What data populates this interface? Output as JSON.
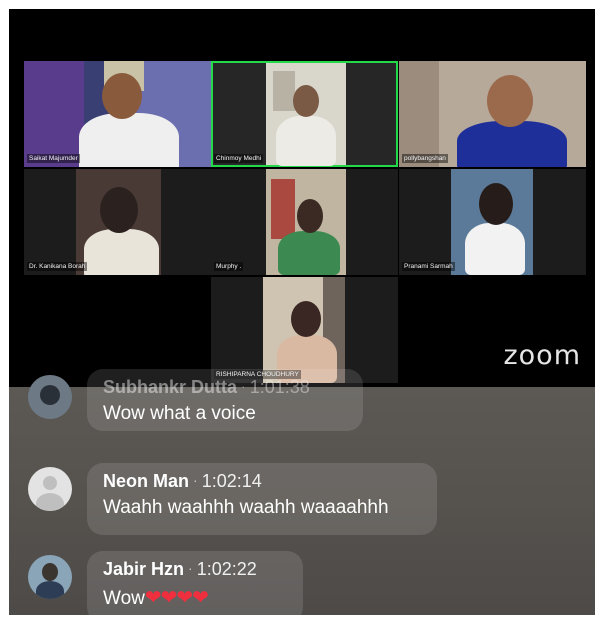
{
  "meeting": {
    "brand": "zoom",
    "participants": [
      {
        "name": "Saikat Majumder"
      },
      {
        "name": "Chinmoy Medhi"
      },
      {
        "name": "pollybangshan"
      },
      {
        "name": "Dr. Kanikana Borah"
      },
      {
        "name": "Murphy ."
      },
      {
        "name": "Pranami Sarmah"
      },
      {
        "name": "RISHIPARNA CHOUDHURY"
      }
    ],
    "active_speaker": "Chinmoy Medhi"
  },
  "chat": {
    "messages": [
      {
        "author": "Subhankr Dutta",
        "time": "1:01:38",
        "text": "Wow what a voice"
      },
      {
        "author": "Neon Man",
        "time": "1:02:14",
        "text": "Waahh waahhh waahh waaaahhh"
      },
      {
        "author": "Jabir Hzn",
        "time": "1:02:22",
        "text": "Wow",
        "emoji": "❤❤❤❤"
      }
    ]
  },
  "colors": {
    "active_border": "#23d94a",
    "heart": "#ef2f3d",
    "chat_bg": "#55514d"
  }
}
